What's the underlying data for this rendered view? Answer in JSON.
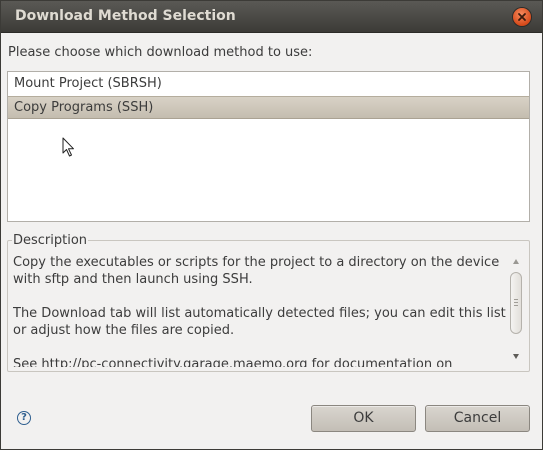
{
  "window": {
    "title": "Download Method Selection"
  },
  "dialog": {
    "prompt": "Please choose which download method to use:",
    "methods": [
      {
        "label": "Mount Project (SBRSH)",
        "selected": false
      },
      {
        "label": "Copy Programs (SSH)",
        "selected": true
      }
    ],
    "description": {
      "legend": "Description",
      "paragraphs": [
        "Copy the executables or scripts for the project to a directory on the device with sftp and then launch using SSH.",
        "The Download tab will list automatically detected files; you can edit this list or adjust how the files are copied.",
        "See http://pc-connectivity.garage.maemo.org for documentation on"
      ]
    },
    "help_glyph": "?",
    "ok_label": "OK",
    "cancel_label": "Cancel"
  },
  "icons": {
    "close": "close-icon",
    "help": "help-icon",
    "cursor": "mouse-pointer-icon"
  },
  "colors": {
    "titlebar": "#3c3b37",
    "close_button": "#d64a1a",
    "selection": "#c4bdaf",
    "background": "#f2f1f0"
  }
}
